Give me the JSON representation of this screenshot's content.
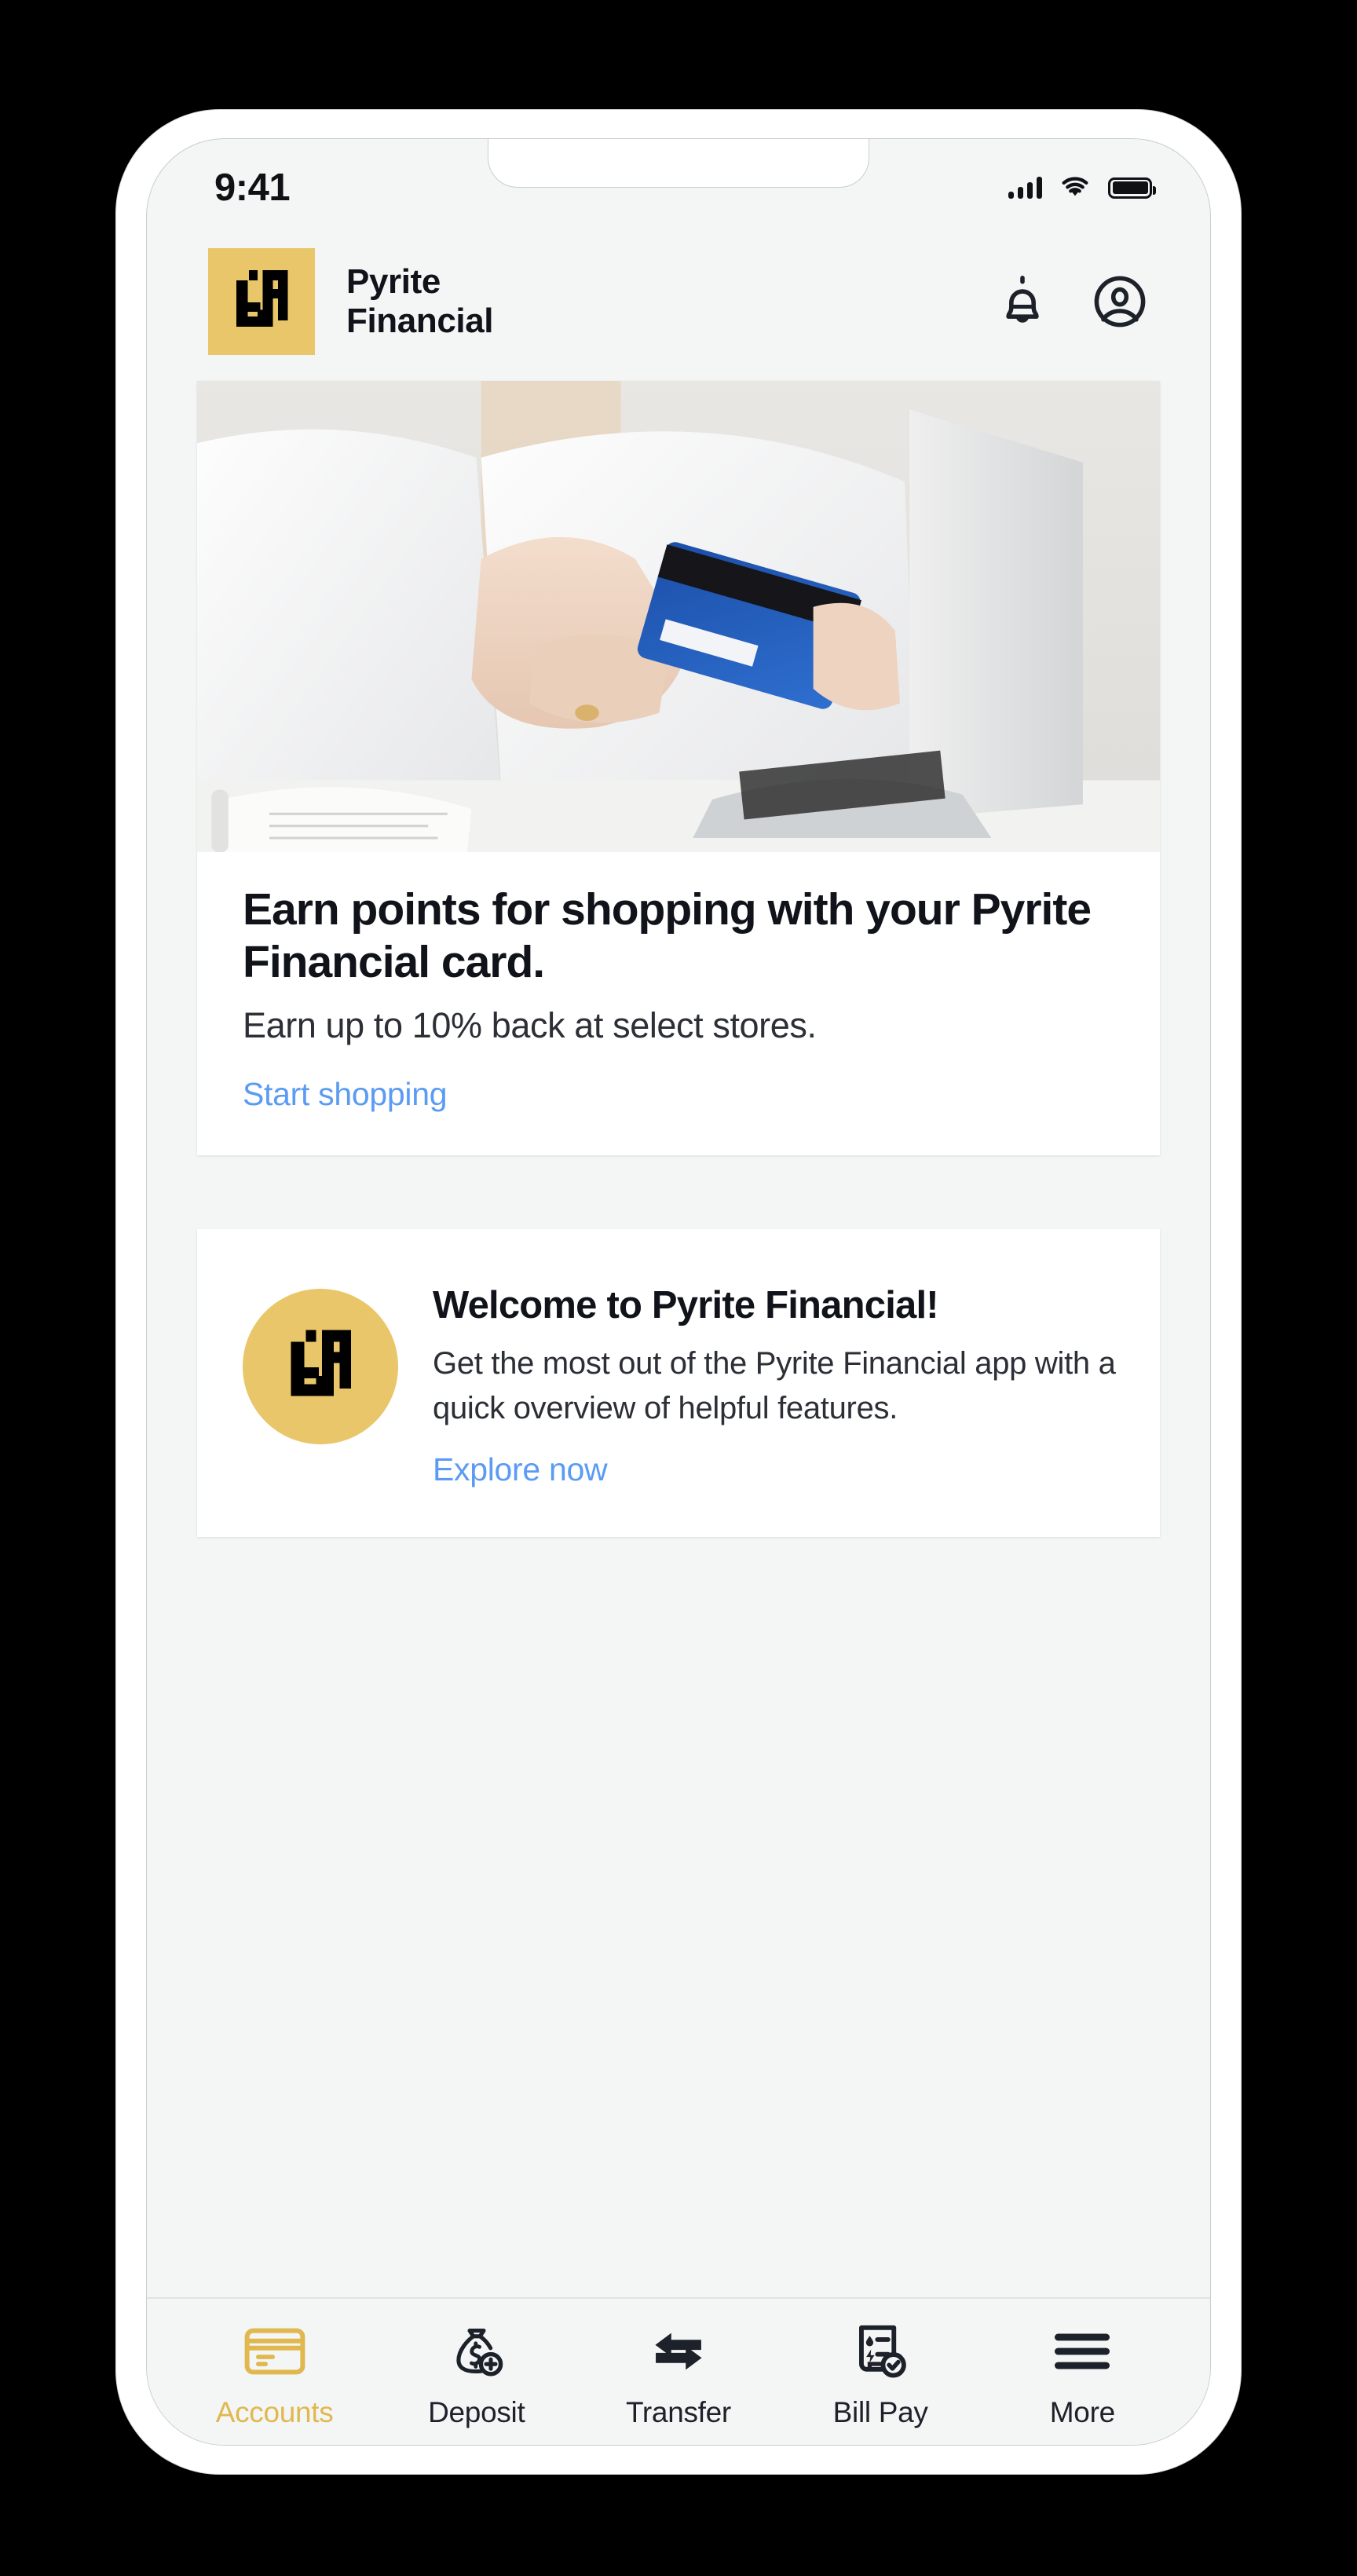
{
  "status_bar": {
    "time": "9:41",
    "icons": [
      "cellular-signal-icon",
      "wifi-icon",
      "battery-icon"
    ]
  },
  "header": {
    "logo_icon": "pyrite-financial-logo-icon",
    "brand_name": "Pyrite\nFinancial",
    "notifications_icon": "bell-icon",
    "profile_icon": "account-circle-icon"
  },
  "promo_card": {
    "image_alt": "person holding a blue credit card while using a silver laptop",
    "title": "Earn points for shopping with your Pyrite Financial card.",
    "subtitle": "Earn up to 10% back at select stores.",
    "link_label": "Start shopping"
  },
  "welcome_card": {
    "avatar_icon": "pyrite-financial-logo-icon",
    "title": "Welcome to Pyrite Financial!",
    "body": "Get the most out of the Pyrite Financial app with a quick overview of helpful features.",
    "link_label": "Explore now"
  },
  "tab_bar": {
    "items": [
      {
        "label": "Accounts",
        "icon": "credit-card-icon",
        "active": true
      },
      {
        "label": "Deposit",
        "icon": "money-bag-plus-icon",
        "active": false
      },
      {
        "label": "Transfer",
        "icon": "transfer-arrows-icon",
        "active": false
      },
      {
        "label": "Bill Pay",
        "icon": "bill-check-icon",
        "active": false
      },
      {
        "label": "More",
        "icon": "hamburger-menu-icon",
        "active": false
      }
    ]
  },
  "colors": {
    "brand_gold": "#E9C669",
    "active_tab": "#E0B84F",
    "link_blue": "#5B9BF3",
    "text_dark": "#11131A",
    "screen_bg": "#F4F6F6",
    "card_bg": "#FFFFFF"
  }
}
